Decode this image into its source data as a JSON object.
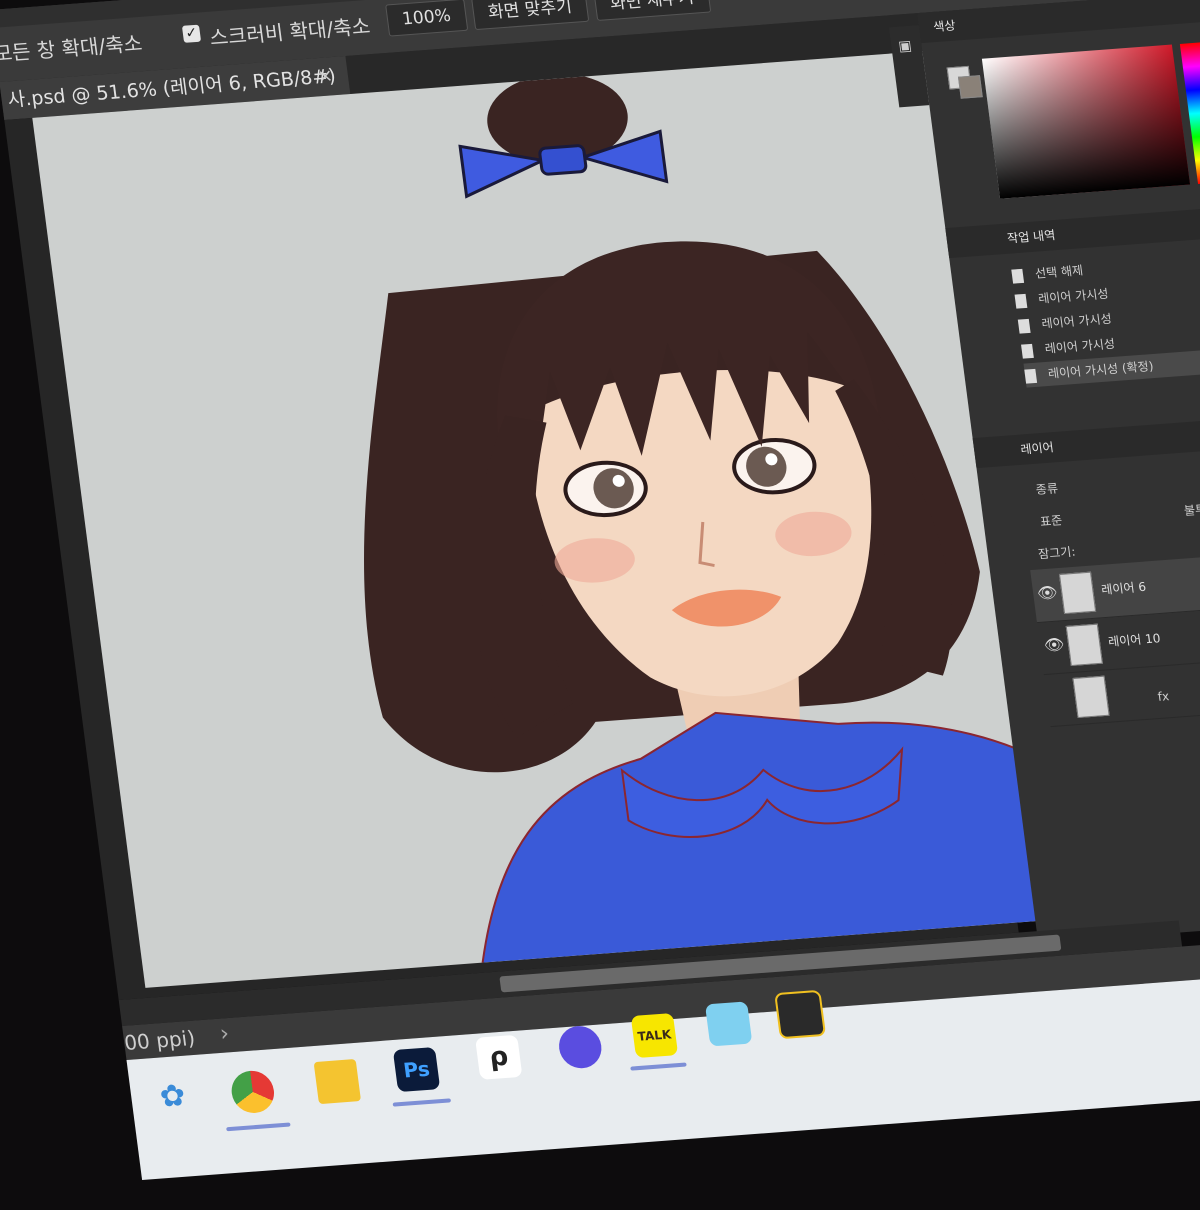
{
  "options_bar": {
    "all_windows_zoom_label": "모든 창 확대/축소",
    "scrubby_zoom_label": "스크러비 확대/축소",
    "scrubby_zoom_checked": true,
    "zoom_percent": "100%",
    "fit_screen": "화면 맞추기",
    "fill_screen": "화면 채우기"
  },
  "document_tab": {
    "title": "사.psd @ 51.6% (레이어 6, RGB/8#)",
    "close": "×"
  },
  "color_panel": {
    "tab_active": "색상",
    "foreground_color": "#d8d8d8",
    "background_color": "#8a8178",
    "field_hue": "#d11a2a"
  },
  "history_panel": {
    "tab_active": "작업 내역",
    "items": [
      "선택 해제",
      "레이어 가시성",
      "레이어 가시성",
      "레이어 가시성",
      "레이어 가시성 (확정)"
    ]
  },
  "layers_panel": {
    "tab_active": "레이어",
    "filter_kind": "종류",
    "blend_mode": "표준",
    "opacity_label": "불투명도:",
    "lock_label": "잠그기:",
    "layers": [
      {
        "name": "레이어 6",
        "visible": true,
        "selected": true
      },
      {
        "name": "레이어 10",
        "visible": true,
        "selected": false
      },
      {
        "name": "",
        "visible": false,
        "selected": false
      }
    ],
    "footer_fx": "fx"
  },
  "status": {
    "text": "00 ppi)",
    "arrow": "›"
  },
  "taskbar": {
    "photoshop_label": "Ps",
    "kakaotalk_label": "TALK",
    "clip_studio_label": "ρ"
  },
  "colors": {
    "app_bg": "#323232",
    "canvas_bg": "#cdd0cf",
    "ribbon_blue": "#3f5be0",
    "shirt_blue": "#3a5ad8",
    "hair": "#3a2422",
    "skin": "#f4d8c2"
  }
}
